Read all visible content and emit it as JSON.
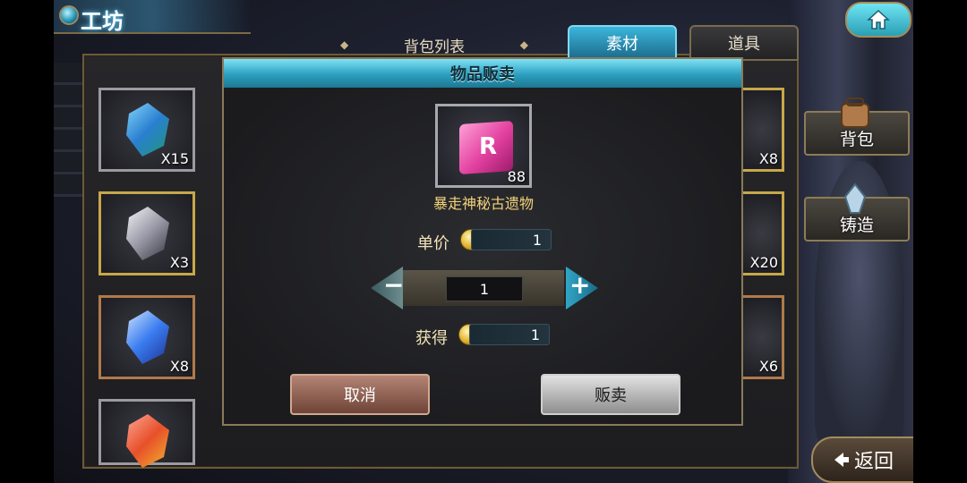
{
  "header": {
    "title": "工坊"
  },
  "list_bar": {
    "label": "背包列表"
  },
  "tabs": [
    {
      "label": "素材",
      "active": true
    },
    {
      "label": "道具",
      "active": false
    }
  ],
  "inventory": {
    "left_items": [
      {
        "count": "X15",
        "color": "#3fa6e8"
      },
      {
        "count": "X3",
        "color": "#c8c8d0"
      },
      {
        "count": "X8",
        "color": "#3a7cf0"
      },
      {
        "count": "",
        "color": "#e8502a"
      }
    ],
    "right_items": [
      {
        "count": "X8",
        "color": "#d84a9a"
      },
      {
        "count": "X20",
        "color": "#9aa8c0"
      },
      {
        "count": "X6",
        "color": "#e8c040"
      }
    ]
  },
  "side": {
    "bag_label": "背包",
    "forge_label": "铸造",
    "back_label": "返回"
  },
  "dialog": {
    "title": "物品贩卖",
    "item_letter": "R",
    "item_count": "88",
    "item_name": "暴走神秘古遗物",
    "unit_price_label": "单价",
    "unit_price_value": "1",
    "quantity": "1",
    "gain_label": "获得",
    "gain_value": "1",
    "minus": "−",
    "plus": "+",
    "cancel_label": "取消",
    "sell_label": "贩卖"
  },
  "colors": {
    "accent_cyan": "#2b9fbe",
    "gold_text": "#f2d27a",
    "frame_gold": "#8a7a5a"
  }
}
